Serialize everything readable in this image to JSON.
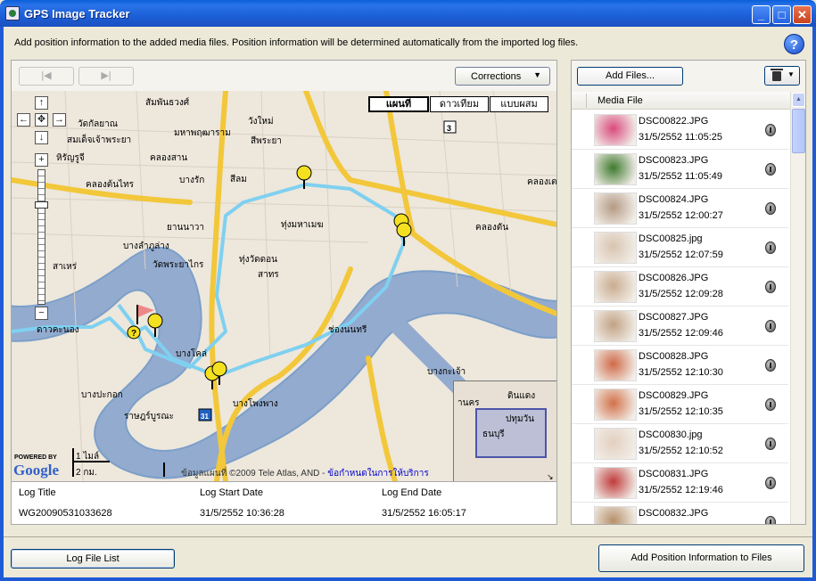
{
  "window": {
    "title": "GPS Image Tracker",
    "minimize_label": "_",
    "maximize_label": "□",
    "close_label": "✕"
  },
  "instruction": "Add position information to the added media files. Position information will be determined automatically from the imported log files.",
  "help_label": "?",
  "map_toolbar": {
    "prev_label": "|◀",
    "next_label": "▶|",
    "corrections_label": "Corrections",
    "corrections_arrow": "▼"
  },
  "map": {
    "map_types": [
      "แผนที่",
      "ดาวเทียม",
      "แบบผสม"
    ],
    "active_map_type": "แผนที่",
    "zoom_in": "+",
    "zoom_out": "−",
    "pan_up": "↑",
    "pan_down": "↓",
    "pan_left": "←",
    "pan_right": "→",
    "pan_center": "✥",
    "labels": [
      "สัมพันธวงศ์",
      "วัดกัลยาณ",
      "มหาพฤฒาราม",
      "วังใหม่",
      "สมเด็จเจ้าพระยา",
      "สีพระยา",
      "หิรัญรูจี",
      "คลองสาน",
      "คลองต้นไทร",
      "บางรัก",
      "สีลม",
      "ทุ่งมหาเมฆ",
      "ยานนาวา",
      "บางลำภูล่าง",
      "สาเหร่",
      "วัดพระยาไกร",
      "ทุ่งวัดดอน",
      "สาทร",
      "คลองเตย",
      "คลองตัน",
      "ดาวคะนอง",
      "บางโคล่",
      "ช่องนนทรี",
      "บางกะเจ้า",
      "บางปะกอก",
      "ราษฎร์บูรณะ",
      "บางโพงพาง"
    ],
    "minimap_labels": [
      "านคร",
      "ดินแดง",
      "ปทุมวัน",
      "ธนบุรี"
    ],
    "scale": {
      "miles": "1 ไมล์",
      "km": "2 กม."
    },
    "google_powered": "POWERED BY",
    "google_logo": "Google",
    "copyright": "ข้อมูลแผนที่ ©2009 Tele Atlas, AND - ",
    "terms_link": "ข้อกำหนดในการให้บริการ",
    "route_color": "#7fd0f0",
    "road_color": "#f2c73a",
    "river_color": "#7b9fc9"
  },
  "log_info": {
    "headers": {
      "title": "Log Title",
      "start": "Log Start Date",
      "end": "Log End Date"
    },
    "values": {
      "title": "WG20090531033628",
      "start": "31/5/2552 10:36:28",
      "end": "31/5/2552 16:05:17"
    }
  },
  "media": {
    "add_files_label": "Add Files...",
    "column_header": "Media File",
    "files": [
      {
        "name": "DSC00822.JPG",
        "date": "31/5/2552 11:05:25",
        "thumb": "#d94a7d"
      },
      {
        "name": "DSC00823.JPG",
        "date": "31/5/2552 11:05:49",
        "thumb": "#3f7a2e"
      },
      {
        "name": "DSC00824.JPG",
        "date": "31/5/2552 12:00:27",
        "thumb": "#b49a84"
      },
      {
        "name": "DSC00825.jpg",
        "date": "31/5/2552 12:07:59",
        "thumb": "#d8c4b0"
      },
      {
        "name": "DSC00826.JPG",
        "date": "31/5/2552 12:09:28",
        "thumb": "#c9ac90"
      },
      {
        "name": "DSC00827.JPG",
        "date": "31/5/2552 12:09:46",
        "thumb": "#c2a285"
      },
      {
        "name": "DSC00828.JPG",
        "date": "31/5/2552 12:10:30",
        "thumb": "#cf6a48"
      },
      {
        "name": "DSC00829.JPG",
        "date": "31/5/2552 12:10:35",
        "thumb": "#d2714a"
      },
      {
        "name": "DSC00830.jpg",
        "date": "31/5/2552 12:10:52",
        "thumb": "#e3cfc0"
      },
      {
        "name": "DSC00831.JPG",
        "date": "31/5/2552 12:19:46",
        "thumb": "#c03b3b"
      },
      {
        "name": "DSC00832.JPG",
        "date": "",
        "thumb": "#b6906a"
      }
    ]
  },
  "footer": {
    "log_file_list_label": "Log File List",
    "add_position_label": "Add Position Information to Files"
  }
}
